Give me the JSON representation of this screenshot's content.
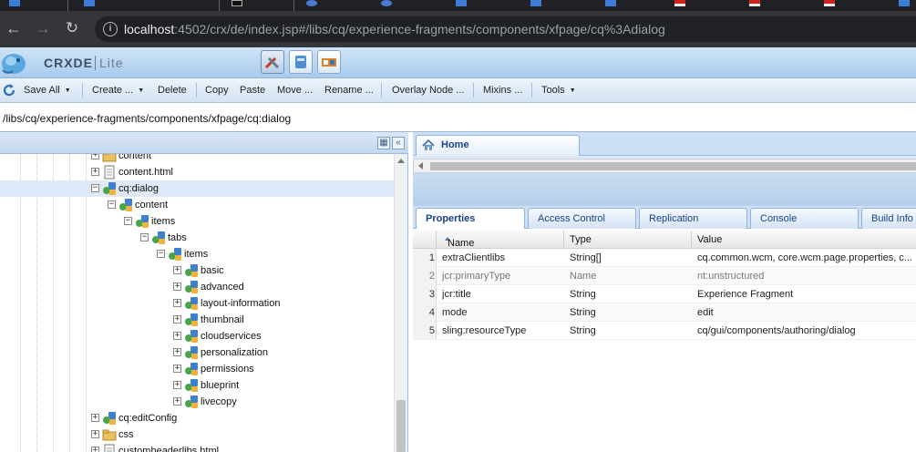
{
  "browser": {
    "address_host": "localhost",
    "address_rest": ":4502/crx/de/index.jsp#/libs/cq/experience-fragments/components/xfpage/cq%3Adialog"
  },
  "app": {
    "brand_main": "CRXDE",
    "brand_sub": "Lite"
  },
  "toolbar": {
    "save_all": "Save All",
    "create": "Create ...",
    "delete": "Delete",
    "copy": "Copy",
    "paste": "Paste",
    "move": "Move ...",
    "rename": "Rename ...",
    "overlay": "Overlay Node ...",
    "mixins": "Mixins ...",
    "tools": "Tools"
  },
  "path": "/libs/cq/experience-fragments/components/xfpage/cq:dialog",
  "tree": {
    "rows": [
      {
        "label": "content",
        "expanded": false,
        "selected": false,
        "kind": "folder"
      },
      {
        "label": "content.html",
        "expanded": false,
        "selected": false,
        "kind": "file"
      },
      {
        "label": "cq:dialog",
        "expanded": true,
        "selected": true,
        "kind": "node"
      },
      {
        "label": "content",
        "expanded": true,
        "selected": false,
        "kind": "node"
      },
      {
        "label": "items",
        "expanded": true,
        "selected": false,
        "kind": "node"
      },
      {
        "label": "tabs",
        "expanded": true,
        "selected": false,
        "kind": "node"
      },
      {
        "label": "items",
        "expanded": true,
        "selected": false,
        "kind": "node"
      },
      {
        "label": "basic",
        "expanded": false,
        "selected": false,
        "kind": "node"
      },
      {
        "label": "advanced",
        "expanded": false,
        "selected": false,
        "kind": "node"
      },
      {
        "label": "layout-information",
        "expanded": false,
        "selected": false,
        "kind": "node"
      },
      {
        "label": "thumbnail",
        "expanded": false,
        "selected": false,
        "kind": "node"
      },
      {
        "label": "cloudservices",
        "expanded": false,
        "selected": false,
        "kind": "node"
      },
      {
        "label": "personalization",
        "expanded": false,
        "selected": false,
        "kind": "node"
      },
      {
        "label": "permissions",
        "expanded": false,
        "selected": false,
        "kind": "node"
      },
      {
        "label": "blueprint",
        "expanded": false,
        "selected": false,
        "kind": "node"
      },
      {
        "label": "livecopy",
        "expanded": false,
        "selected": false,
        "kind": "node"
      },
      {
        "label": "cq:editConfig",
        "expanded": false,
        "selected": false,
        "kind": "node"
      },
      {
        "label": "css",
        "expanded": false,
        "selected": false,
        "kind": "folder"
      },
      {
        "label": "customheaderlibs.html",
        "expanded": false,
        "selected": false,
        "kind": "file"
      }
    ]
  },
  "editor": {
    "home_tab": "Home"
  },
  "property_tabs": [
    "Properties",
    "Access Control",
    "Replication",
    "Console",
    "Build Info"
  ],
  "properties": {
    "columns": [
      "Name",
      "Type",
      "Value"
    ],
    "rows": [
      {
        "num": "1",
        "name": "extraClientlibs",
        "type": "String[]",
        "value": "cq.common.wcm, core.wcm.page.properties, c...",
        "muted": false
      },
      {
        "num": "2",
        "name": "jcr:primaryType",
        "type": "Name",
        "value": "nt:unstructured",
        "muted": true
      },
      {
        "num": "3",
        "name": "jcr:title",
        "type": "String",
        "value": "Experience Fragment",
        "muted": false
      },
      {
        "num": "4",
        "name": "mode",
        "type": "String",
        "value": "edit",
        "muted": false
      },
      {
        "num": "5",
        "name": "sling:resourceType",
        "type": "String",
        "value": "cq/gui/components/authoring/dialog",
        "muted": false
      }
    ]
  },
  "colors": {
    "accent": "#15428b",
    "selection": "#dfe8f6",
    "panel_border": "#99bbe8"
  }
}
